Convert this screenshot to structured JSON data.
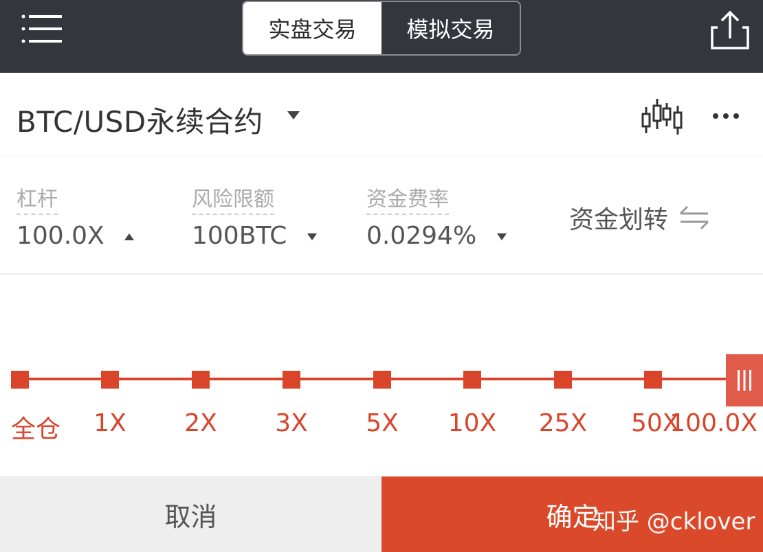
{
  "header": {
    "tabs": [
      {
        "label": "实盘交易",
        "active": true
      },
      {
        "label": "模拟交易",
        "active": false
      }
    ],
    "menu_icon": "menu-icon",
    "share_icon": "share-icon"
  },
  "contract": {
    "title": "BTC/USD永续合约",
    "chart_icon": "candlestick-icon",
    "more_icon": "more-icon"
  },
  "stats": {
    "leverage": {
      "label": "杠杆",
      "value": "100.0X"
    },
    "risk_limit": {
      "label": "风险限额",
      "value": "100BTC"
    },
    "funding_rate": {
      "label": "资金费率",
      "value": "0.0294%"
    },
    "transfer_label": "资金划转"
  },
  "slider": {
    "labels": [
      "全仓",
      "1X",
      "2X",
      "3X",
      "5X",
      "10X",
      "25X",
      "50X",
      "100.0X"
    ],
    "selected_index": 8,
    "selected_value": "100.0X"
  },
  "actions": {
    "cancel": "取消",
    "confirm": "确定"
  },
  "watermark": "知乎 @cklover",
  "colors": {
    "header_bg": "#33373d",
    "accent": "#d9452b",
    "confirm_bg": "#da4a2a",
    "cancel_bg": "#eeeeee"
  }
}
